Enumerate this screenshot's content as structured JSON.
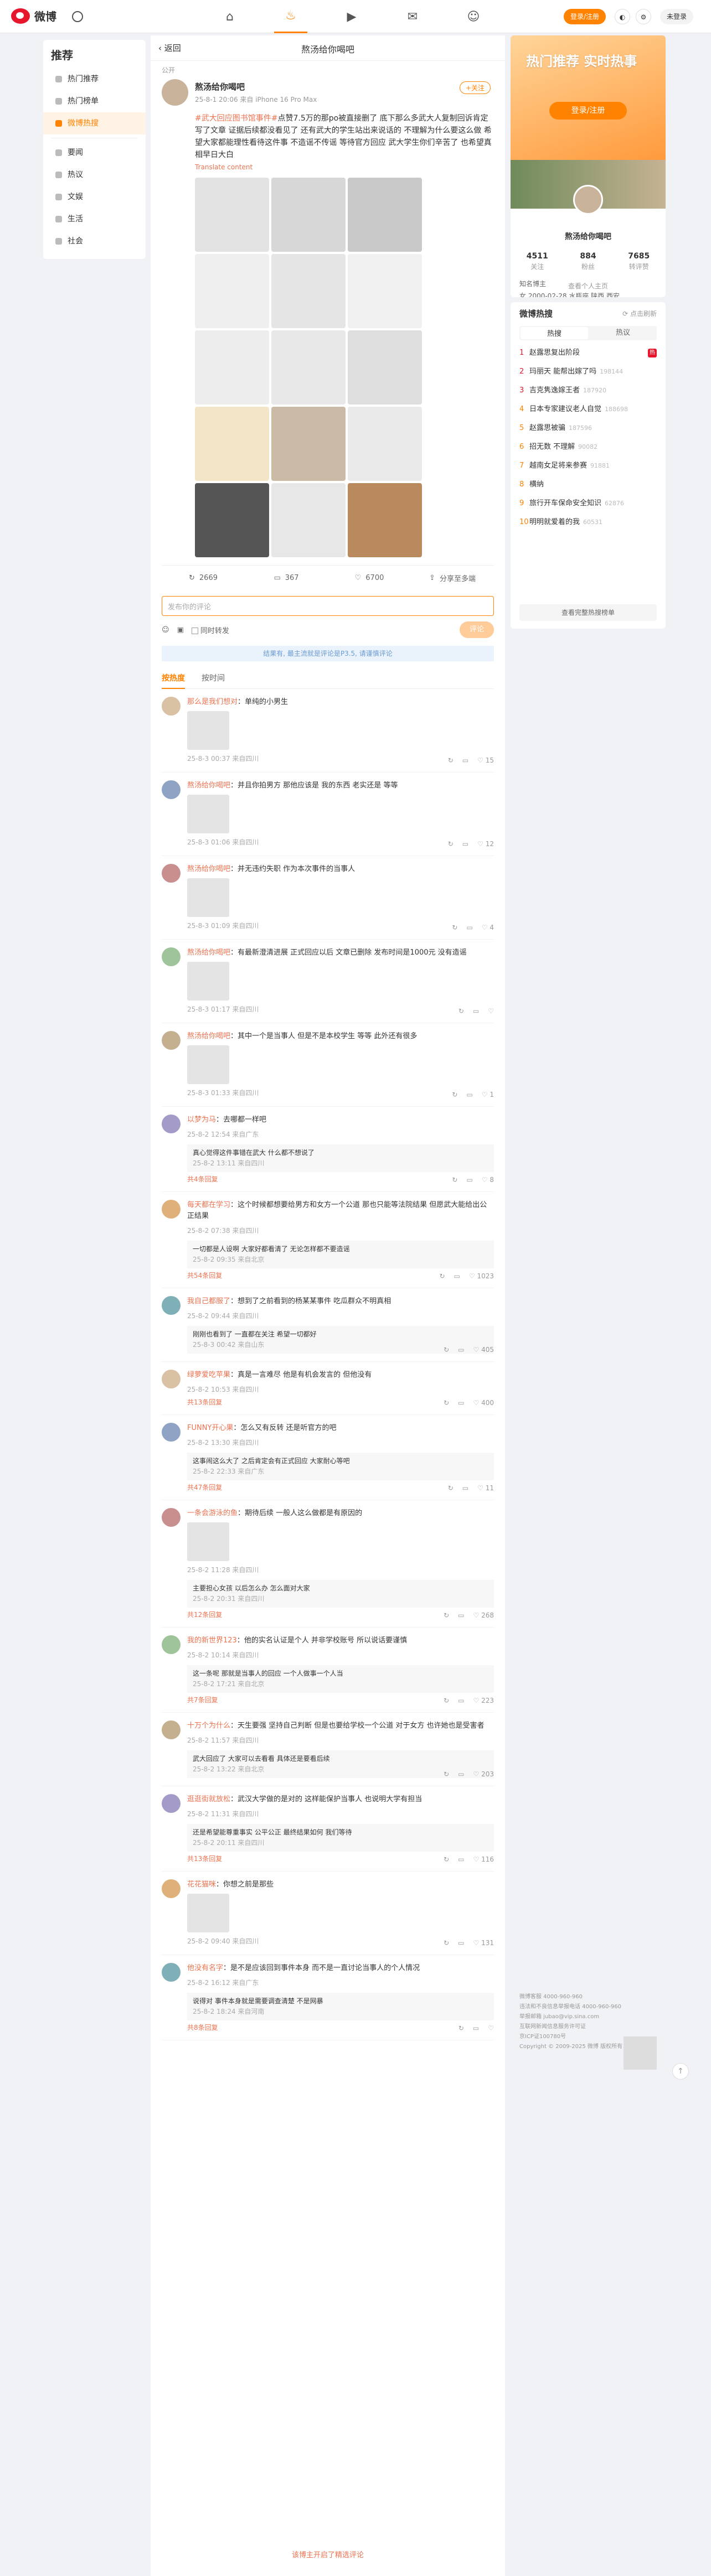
{
  "nav": {
    "logo": "微博",
    "login": "登录/注册",
    "unlogged": "未登录"
  },
  "leftnav": {
    "title": "推荐",
    "items": [
      "热门推荐",
      "热门榜单",
      "微博热搜",
      "要闻",
      "热议",
      "文娱",
      "生活",
      "社会"
    ]
  },
  "header": {
    "back": "返回",
    "title": "熬汤给你喝吧"
  },
  "crumb": "公开",
  "post": {
    "author": "熬汤给你喝吧",
    "meta": "25-8-1 20:06 来自 iPhone 16 Pro Max",
    "follow": "+关注",
    "tag": "#武大回应图书馆事件#",
    "text": "点赞7.5万的那po被直接删了 底下那么多武大人复制回诉肯定写了文章 证据后续都没看见了 还有武大的学生站出来说话的 不理解为什么要这么做 希望大家都能理性看待这件事 不造谣不传谣 等待官方回应 武大学生你们辛苦了 也希望真相早日大白",
    "translate": "Translate content",
    "repost": "2669",
    "comment": "367",
    "like": "6700",
    "share": "分享至多端"
  },
  "compose": {
    "placeholder": "发布你的评论",
    "repost_check": "同时转发",
    "send": "评论"
  },
  "notice": "结果有, 最主流就是评论是P3.5, 请谨慎评论",
  "tabs": [
    "按热度",
    "按时间"
  ],
  "comments": [
    {
      "name": "那么是我们想对",
      "text": "单纯的小男生",
      "meta": "25-8-3 00:37 来自四川",
      "likes": "15"
    },
    {
      "name": "熬汤给你喝吧",
      "text": "并且你拍男方 那他应该是 我的东西 老实还是 等等",
      "meta": "25-8-3 01:06 来自四川",
      "likes": "12"
    },
    {
      "name": "熬汤给你喝吧",
      "text": "并无违约失职 作为本次事件的当事人",
      "meta": "25-8-3 01:09 来自四川",
      "likes": "4"
    },
    {
      "name": "熬汤给你喝吧",
      "text": "有最新澄清进展 正式回应以后 文章已删除 发布时间是1000元 没有造谣",
      "meta": "25-8-3 01:17 来自四川",
      "likes": ""
    },
    {
      "name": "熬汤给你喝吧",
      "text": "其中一个是当事人 但是不是本校学生 等等 此外还有很多",
      "meta": "25-8-3 01:33 来自四川",
      "likes": "1"
    },
    {
      "name": "以梦为马",
      "text": "去哪都一样吧",
      "meta": "25-8-2 12:54 来自广东",
      "likes": "8",
      "reply": {
        "text": "真心觉得这件事错在武大 什么都不想说了",
        "meta": "25-8-2 13:11 来自四川"
      },
      "more": "共4条回复"
    },
    {
      "name": "每天都在学习",
      "text": "这个时候都想要给男方和女方一个公道 那也只能等法院结果 但愿武大能给出公正结果",
      "meta": "25-8-2 07:38 来自四川",
      "likes": "1023",
      "reply": {
        "text": "一切都是人设啊 大家好都看清了 无论怎样都不要造谣",
        "meta": "25-8-2 09:35 来自北京"
      },
      "more": "共54条回复"
    },
    {
      "name": "我自己都服了",
      "text": "想到了之前看到的杨某某事件 吃瓜群众不明真相",
      "meta": "25-8-2 09:44 来自四川",
      "likes": "405",
      "reply": {
        "text": "刚刚也看到了 一直都在关注 希望一切都好",
        "meta": "25-8-3 00:42 来自山东"
      },
      "more": ""
    },
    {
      "name": "绿萝爱吃苹果",
      "text": "真是一言难尽 他是有机会发言的 但他没有",
      "meta": "25-8-2 10:53 来自四川",
      "likes": "400",
      "more": "共13条回复"
    },
    {
      "name": "FUNNY开心果",
      "text": "怎么又有反转 还是听官方的吧",
      "meta": "25-8-2 13:30 来自四川",
      "likes": "11",
      "reply": {
        "text": "这事闹这么大了 之后肯定会有正式回应 大家耐心等吧",
        "meta": "25-8-2 22:33 来自广东"
      },
      "more": "共47条回复"
    },
    {
      "name": "一条会游泳的鱼",
      "text": "期待后续 一般人这么做都是有原因的",
      "meta": "25-8-2 11:28 来自四川",
      "likes": "268",
      "reply": {
        "text": "主要担心女孩 以后怎么办 怎么面对大家",
        "meta": "25-8-2 20:31 来自四川"
      },
      "more": "共12条回复"
    },
    {
      "name": "我的新世界123",
      "text": "他的实名认证是个人 并非学校账号 所以说话要谨慎",
      "meta": "25-8-2 10:14 来自四川",
      "likes": "223",
      "reply": {
        "text": "这一条呢 那就是当事人的回应 一个人做事一个人当",
        "meta": "25-8-2 17:21 来自北京"
      },
      "more": "共7条回复"
    },
    {
      "name": "十万个为什么",
      "text": "天生要强 坚持自己判断 但是也要给学校一个公道 对于女方 也许她也是受害者",
      "meta": "25-8-2 11:57 来自四川",
      "likes": "203",
      "reply": {
        "text": "武大回应了 大家可以去看看 具体还是要看后续",
        "meta": "25-8-2 13:22 来自北京"
      },
      "more": ""
    },
    {
      "name": "逛逛街就放松",
      "text": "武汉大学做的是对的 这样能保护当事人 也说明大学有担当",
      "meta": "25-8-2 11:31 来自四川",
      "likes": "116",
      "reply": {
        "text": "还是希望能尊重事实 公平公正 最终结果如何 我们等待",
        "meta": "25-8-2 20:11 来自四川"
      },
      "more": "共13条回复"
    },
    {
      "name": "花花猫咪",
      "text": "你想之前是那些",
      "meta": "25-8-2 09:40 来自四川",
      "likes": "131"
    },
    {
      "name": "他没有名字",
      "text": "是不是应该回到事件本身 而不是一直讨论当事人的个人情况",
      "meta": "25-8-2 16:12 来自广东",
      "likes": "",
      "reply": {
        "text": "说得对 事件本身就是需要调查清楚 不是网暴",
        "meta": "25-8-2 18:24 来自河南"
      },
      "more": "共8条回复"
    }
  ],
  "footer_more": "该博主开启了精选评论",
  "profile": {
    "banner": "热门推荐 实时热事",
    "login": "登录/注册",
    "name": "熬汤给你喝吧",
    "stats": [
      {
        "v": "4511",
        "k": "关注"
      },
      {
        "v": "884",
        "k": "粉丝"
      },
      {
        "v": "7685",
        "k": "转评赞"
      }
    ],
    "info1": "知名博主",
    "info2": "女  2000-02-28 水瓶座  陕西 西安",
    "more": "查看个人主页"
  },
  "hot": {
    "title": "微博热搜",
    "refresh": "点击刷新",
    "tabs": [
      "热搜",
      "热议"
    ],
    "items": [
      {
        "r": "1",
        "t": "赵露思复出阶段",
        "n": "",
        "b": "热"
      },
      {
        "r": "2",
        "t": "玛丽天 能帮出嫁了吗",
        "n": "198144",
        "b": ""
      },
      {
        "r": "3",
        "t": "吉克隽逸嫁王者",
        "n": "187920",
        "b": ""
      },
      {
        "r": "4",
        "t": "日本专家建议老人自觉",
        "n": "188698",
        "b": ""
      },
      {
        "r": "5",
        "t": "赵露思被骗",
        "n": "187596",
        "b": ""
      },
      {
        "r": "6",
        "t": "招无数 不理解",
        "n": "90082",
        "b": ""
      },
      {
        "r": "7",
        "t": "越南女足将来参赛",
        "n": "91881",
        "b": ""
      },
      {
        "r": "8",
        "t": "横纳",
        "n": "",
        "b": ""
      },
      {
        "r": "9",
        "t": "旅行开车保命安全知识",
        "n": "62876",
        "b": ""
      },
      {
        "r": "10",
        "t": "明明就爱着的我",
        "n": "60531",
        "b": ""
      }
    ],
    "more": "查看完整热搜榜单"
  },
  "footer": {
    "lines": [
      "微博客服 4000-960-960",
      "违法和不良信息举报电话 4000-960-960",
      "举报邮箱 jubao@vip.sina.com",
      "互联网新闻信息服务许可证",
      "京ICP证100780号",
      "Copyright © 2009-2025 微博 版权所有"
    ]
  }
}
